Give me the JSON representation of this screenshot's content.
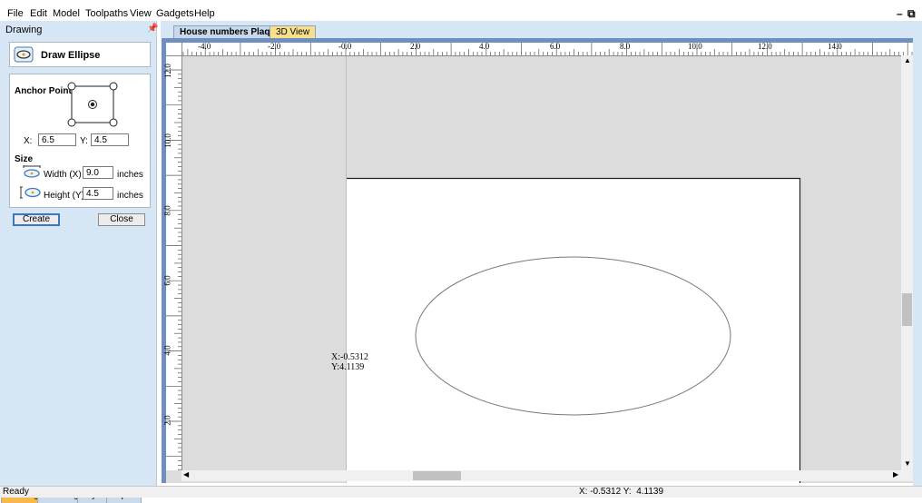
{
  "menu": [
    "File",
    "Edit",
    "Model",
    "Toolpaths",
    "View",
    "Gadgets",
    "Help"
  ],
  "panel": {
    "title": "Drawing",
    "tool_title": "Draw Ellipse",
    "anchor_label": "Anchor Point",
    "x_label": "X:",
    "x_value": "6.5",
    "y_label": "Y:",
    "y_value": "4.5",
    "size_label": "Size",
    "width_label": "Width (X)",
    "width_value": "9.0",
    "width_units": "inches",
    "height_label": "Height (Y)",
    "height_value": "4.5",
    "height_units": "inches",
    "create_label": "Create",
    "close_label": "Close"
  },
  "bottom_tabs": [
    "Drawing",
    "Modeling",
    "Layers",
    "Clipart"
  ],
  "doc_tabs": [
    "House numbers Plaque",
    "3D View"
  ],
  "ruler": {
    "h_labels": [
      "-4.0",
      "-2.0",
      "-0.0",
      "2.0",
      "4.0",
      "6.0",
      "8.0",
      "10.0",
      "12.0",
      "14.0"
    ],
    "v_labels": [
      "12.0",
      "10.0",
      "8.0",
      "6.0",
      "4.0",
      "2.0"
    ]
  },
  "cursor": {
    "x": "X:-0.5312",
    "y": "Y:4.1139"
  },
  "status": {
    "text": "Ready",
    "coords": "X: -0.5312 Y:  4.1139"
  },
  "colors": {
    "panel_bg": "#d7e6f4",
    "active_tab": "#f7b94b",
    "view_frame": "#6e8fbf"
  }
}
